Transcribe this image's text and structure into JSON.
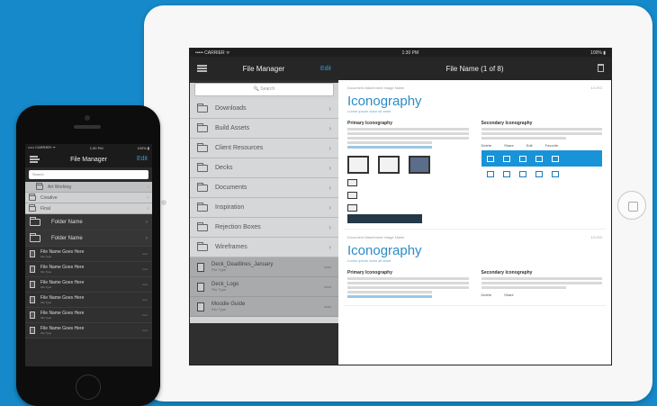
{
  "ipad": {
    "status_left": "••••• CARRIER ᯤ",
    "status_time": "1:30 PM",
    "status_right": "100% ▮",
    "sidebar_title": "File Manager",
    "edit_label": "Edit",
    "document_title": "File Name (1 of 8)",
    "search_placeholder": "🔍 Search",
    "folders": [
      "Downloads",
      "Build Assets",
      "Client Resources",
      "Decks",
      "Documents",
      "Inspiration",
      "Rejection Boxes",
      "Wireframes"
    ],
    "files": [
      {
        "name": "Deck_Deadlines_January",
        "meta": "File Type",
        "size": "xxxx"
      },
      {
        "name": "Deck_Logo",
        "meta": "File Type",
        "size": "xxxx"
      },
      {
        "name": "Moodie Guide",
        "meta": "File Type",
        "size": "xxxx"
      }
    ],
    "cards": [
      {
        "head_left": "Document Attachment Image Name",
        "head_right": "1/1 EO",
        "title": "Iconography",
        "subtitle": "Lorem ipsum dolor sit amet",
        "primary": "Primary Iconography",
        "secondary": "Secondary Iconography",
        "actions": [
          "Delete",
          "Share",
          "Edit",
          "Favorite"
        ]
      },
      {
        "head_left": "Document Attachment Image Name",
        "head_right": "1/1 EO",
        "title": "Iconography",
        "subtitle": "Lorem ipsum dolor sit amet",
        "primary": "Primary Iconography",
        "secondary": "Secondary Iconography",
        "actions": [
          "Delete",
          "Share"
        ]
      }
    ]
  },
  "iphone": {
    "status_left": "••••• CARRIER ᯤ",
    "status_time": "1:30 PM",
    "status_right": "100% ▮",
    "title": "File Manager",
    "edit_label": "Edit",
    "search_placeholder": "Search",
    "light_rows": [
      {
        "label": "Art Working",
        "indent": true
      },
      {
        "label": "Creative",
        "indent": false
      },
      {
        "label": "Final",
        "indent": false
      }
    ],
    "dark_rows": [
      "Folder Name",
      "Folder Name"
    ],
    "file_name": "File Name Goes Here",
    "file_meta": "File Type",
    "file_size": "xxxx",
    "file_count": 6
  }
}
